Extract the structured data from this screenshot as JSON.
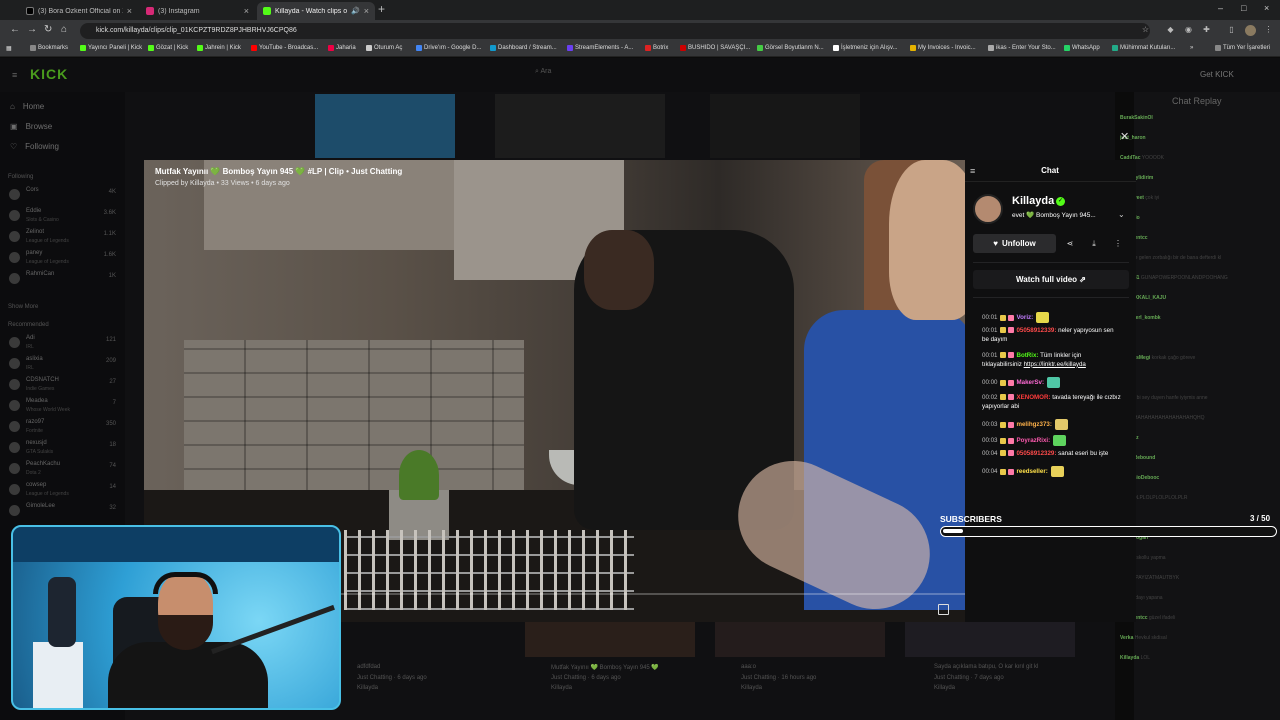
{
  "browser": {
    "tabs": [
      {
        "label": "(3) Bora Özkent Official on X: \"",
        "icon_color": "#111111"
      },
      {
        "label": "(3) Instagram",
        "icon_color": "#d62976"
      },
      {
        "label": "Killayda - Watch clips on Ki",
        "icon_color": "#53fc18"
      }
    ],
    "new_tab": "+",
    "url": "kick.com/killayda/clips/clip_01KCPZT9RDZ8PJHBRHVJ6CPQ86",
    "bookmarks": [
      "Bookmarks",
      "Yayıncı Paneli | Kick",
      "Gözat | Kick",
      "Jahrein | Kick",
      "YouTube - Broadcas...",
      "Jaharia",
      "Oturum Aç",
      "Drive'ım - Google D...",
      "Dashboard / Stream...",
      "StreamElements - A...",
      "Botrix",
      "BUSHIDO | SAVAŞÇI...",
      "Görsel Boyutlanm N...",
      "İşletmeniz için Alışv...",
      "My Invoices - Invoic...",
      "ikas - Enter Your Sto...",
      "WhatsApp",
      "Mühimmat Kutuları..."
    ],
    "all_bookmarks": "Tüm Yer İşaretleri"
  },
  "site": {
    "logo": "KICK",
    "search_placeholder": "Ara",
    "get_kick": "Get KICK",
    "nav": {
      "home": "Home",
      "browse": "Browse",
      "following": "Following"
    },
    "following_header": "Following",
    "recommended_header": "Recommended",
    "show_more": "Show More",
    "following_channels": [
      {
        "name": "Cors",
        "category": "",
        "viewers": "4K"
      },
      {
        "name": "Eddie",
        "category": "Slots & Casino",
        "viewers": "3.6K"
      },
      {
        "name": "Zelinot",
        "category": "League of Legends",
        "viewers": "1.1K"
      },
      {
        "name": "paney",
        "category": "League of Legends",
        "viewers": "1.6K"
      },
      {
        "name": "RahmiCan",
        "category": "",
        "viewers": "1K"
      }
    ],
    "recommended_channels": [
      {
        "name": "Adi",
        "category": "IRL",
        "viewers": "121"
      },
      {
        "name": "aslixia",
        "category": "IRL",
        "viewers": "209"
      },
      {
        "name": "CDSNATCH",
        "category": "Indie Games",
        "viewers": "27"
      },
      {
        "name": "Meadea",
        "category": "Whose World Week",
        "viewers": "7"
      },
      {
        "name": "razo97",
        "category": "Fortnite",
        "viewers": "350"
      },
      {
        "name": "nexusjd",
        "category": "GTA Sulakis",
        "viewers": "18"
      },
      {
        "name": "PeachKachu",
        "category": "Dota 2",
        "viewers": "74"
      },
      {
        "name": "cowsep",
        "category": "League of Legends",
        "viewers": "14"
      },
      {
        "name": "GimoleLee",
        "category": "",
        "viewers": "32"
      }
    ],
    "bg_cards": [
      {
        "title": "Mutfak Yayınıı 💚 Bomboş Yayın 945 💚",
        "category": "Just Chatting · 6 days ago",
        "channel": "Killayda"
      },
      {
        "title": "aaa:o",
        "category": "Just Chatting · 16 hours ago",
        "channel": "Killayda"
      },
      {
        "title": "Sayda açıklama batıpu, O kar kırıl git kl",
        "category": "Just Chatting · 7 days ago",
        "channel": "Killayda"
      },
      {
        "title": "adfdfdad",
        "category": "Just Chatting · 6 days ago",
        "channel": "Killayda"
      }
    ],
    "chat_replay_title": "Chat Replay",
    "chat_replay_lines": [
      {
        "user": "BurakSakinOl",
        "text": ""
      },
      {
        "user": "just_haron",
        "text": ""
      },
      {
        "user": "CadılTac",
        "text": "YOOOOK"
      },
      {
        "user": "selcukylidirim",
        "text": ""
      },
      {
        "user": "kingstreet",
        "text": "çok iyi"
      },
      {
        "user": "turbacio",
        "text": ""
      },
      {
        "user": "im_agentcc",
        "text": ""
      },
      {
        "user": "",
        "text": "kendine gelen zorbalığı bir de bana defterdi kl"
      },
      {
        "user": "AnlaT31",
        "text": "GÜNAPOWERPOONLANDPOOHANG"
      },
      {
        "user": "BAHAKKALI_KAJU",
        "text": ""
      },
      {
        "user": "kuzenlerl_kombk",
        "text": ""
      },
      {
        "user": "Verka",
        "text": ""
      },
      {
        "user": "MagnosMegi",
        "text": "korkak çağo göreve"
      },
      {
        "user": "",
        "text": ""
      },
      {
        "user": "oitadri",
        "text": "bi sey duyen hanfe iyiymis anne"
      },
      {
        "user": "",
        "text": "HAHAHAHAHAHAHAHAHAHAHQHQ"
      },
      {
        "user": "Cotaruz",
        "text": ""
      },
      {
        "user": "SatsoRebound",
        "text": ""
      },
      {
        "user": "EvidenioDebooc",
        "text": ""
      },
      {
        "user": "",
        "text": "LOLBOLPLOLPLOLPLOLPLR"
      },
      {
        "user": "",
        "text": ""
      },
      {
        "user": "dodlykogan",
        "text": ""
      },
      {
        "user": "",
        "text": "Bakinz skollu yapma"
      },
      {
        "user": "",
        "text": "BOOMPAYIZATMAUTBYK"
      },
      {
        "user": "",
        "text": "Bak kadayı yapana"
      },
      {
        "user": "im_agentcc",
        "text": "güzel ifadeli"
      },
      {
        "user": "Verka",
        "text": "Hevkul skdisal"
      },
      {
        "user": "Killayda",
        "text": "LOL"
      }
    ]
  },
  "clip": {
    "title": "Mutfak Yayınıı 💚 Bomboş Yayın 945 💚 #LP | Clip • Just Chatting",
    "meta": "Clipped by Killayda • 33 Views • 6 days ago",
    "progress": 0.0
  },
  "chat": {
    "title": "Chat",
    "channel_name": "Killayda",
    "stream_title": "evet 💚 Bomboş Yayın 945...",
    "unfollow_label": "Unfollow",
    "watch_full_label": "Watch full video",
    "messages": [
      {
        "time": "00:01",
        "user": "Voriz:",
        "user_color": "#c37cff",
        "text": "",
        "emote": "#e6d84a"
      },
      {
        "time": "00:01",
        "user": "05058912339:",
        "user_color": "#ff4b4b",
        "text": " neler yapıyosun sen be dayım",
        "emote": ""
      },
      {
        "time": "00:01",
        "user": "BotRix:",
        "user_color": "#53fc18",
        "text": " Tüm linkler için tıklayabilirsiniz ",
        "link": "https://linktr.ee/killayda",
        "emote": ""
      },
      {
        "time": "00:00",
        "user": "MakerSv:",
        "user_color": "#ff6ad5",
        "text": "",
        "emote": "#4fc7a6"
      },
      {
        "time": "00:02",
        "user": "XENOMOR:",
        "user_color": "#ff3b3b",
        "text": " tavada tereyağı ile cızbız yapıyorlar abi",
        "emote": ""
      },
      {
        "time": "00:03",
        "user": "melihgz373:",
        "user_color": "#ffb24a",
        "text": "",
        "emote": "#e3c96a"
      },
      {
        "time": "00:03",
        "user": "PoyrazRixi:",
        "user_color": "#ff5ab0",
        "text": "",
        "emote": "#5ed35e"
      },
      {
        "time": "00:04",
        "user": "05058912329:",
        "user_color": "#ff4b4b",
        "text": " sanat eseri bu işte",
        "emote": ""
      },
      {
        "time": "00:04",
        "user": "reedseller:",
        "user_color": "#ffe14a",
        "text": "",
        "emote": "#e8d15a"
      }
    ],
    "subscribers_label": "SUBSCRIBERS",
    "subscribers_count": "3 / 50",
    "subscribers_fraction": 0.06
  },
  "colors": {
    "kick_green": "#53fc18",
    "accent": "#53fc18"
  }
}
